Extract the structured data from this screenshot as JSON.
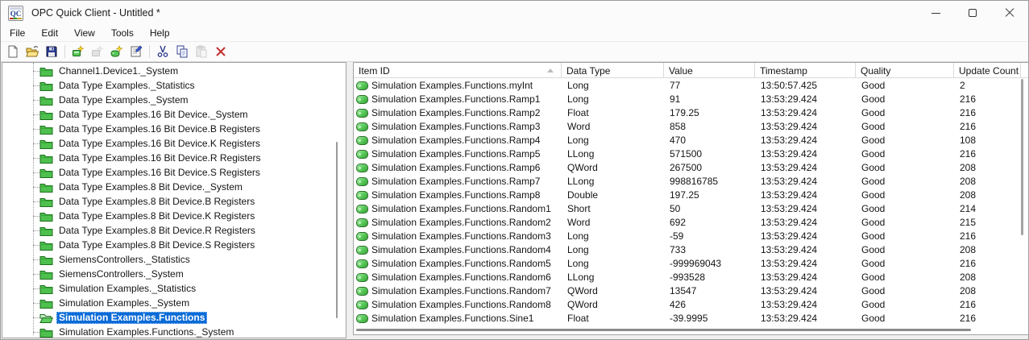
{
  "window": {
    "title": "OPC Quick Client - Untitled *",
    "app_icon_text": "QC"
  },
  "menu": {
    "items": [
      "File",
      "Edit",
      "View",
      "Tools",
      "Help"
    ]
  },
  "toolbar": {
    "buttons": [
      {
        "name": "new-document",
        "enabled": true
      },
      {
        "name": "open-file",
        "enabled": true
      },
      {
        "name": "save-file",
        "enabled": true
      },
      {
        "name": "separator"
      },
      {
        "name": "new-server-connection",
        "enabled": true
      },
      {
        "name": "new-group",
        "enabled": false
      },
      {
        "name": "new-item",
        "enabled": true
      },
      {
        "name": "properties",
        "enabled": true
      },
      {
        "name": "separator"
      },
      {
        "name": "cut",
        "enabled": true
      },
      {
        "name": "copy",
        "enabled": true
      },
      {
        "name": "paste",
        "enabled": false
      },
      {
        "name": "delete",
        "enabled": true
      }
    ]
  },
  "tree": {
    "items": [
      {
        "label": "Channel1.Device1._System"
      },
      {
        "label": "Data Type Examples._Statistics"
      },
      {
        "label": "Data Type Examples._System"
      },
      {
        "label": "Data Type Examples.16 Bit Device._System"
      },
      {
        "label": "Data Type Examples.16 Bit Device.B Registers"
      },
      {
        "label": "Data Type Examples.16 Bit Device.K Registers"
      },
      {
        "label": "Data Type Examples.16 Bit Device.R Registers"
      },
      {
        "label": "Data Type Examples.16 Bit Device.S Registers"
      },
      {
        "label": "Data Type Examples.8 Bit Device._System"
      },
      {
        "label": "Data Type Examples.8 Bit Device.B Registers"
      },
      {
        "label": "Data Type Examples.8 Bit Device.K Registers"
      },
      {
        "label": "Data Type Examples.8 Bit Device.R Registers"
      },
      {
        "label": "Data Type Examples.8 Bit Device.S Registers"
      },
      {
        "label": "SiemensControllers._Statistics"
      },
      {
        "label": "SiemensControllers._System"
      },
      {
        "label": "Simulation Examples._Statistics"
      },
      {
        "label": "Simulation Examples._System"
      },
      {
        "label": "Simulation Examples.Functions",
        "selected": true,
        "open": true
      },
      {
        "label": "Simulation Examples.Functions._System"
      }
    ]
  },
  "grid": {
    "columns": [
      "Item ID",
      "Data Type",
      "Value",
      "Timestamp",
      "Quality",
      "Update Count"
    ],
    "sort": {
      "column": "Item ID",
      "direction": "ascending"
    },
    "rows": [
      {
        "item_id": "Simulation Examples.Functions.myInt",
        "data_type": "Long",
        "value": "77",
        "timestamp": "13:50:57.425",
        "quality": "Good",
        "update_count": "2"
      },
      {
        "item_id": "Simulation Examples.Functions.Ramp1",
        "data_type": "Long",
        "value": "91",
        "timestamp": "13:53:29.424",
        "quality": "Good",
        "update_count": "216"
      },
      {
        "item_id": "Simulation Examples.Functions.Ramp2",
        "data_type": "Float",
        "value": "179.25",
        "timestamp": "13:53:29.424",
        "quality": "Good",
        "update_count": "216"
      },
      {
        "item_id": "Simulation Examples.Functions.Ramp3",
        "data_type": "Word",
        "value": "858",
        "timestamp": "13:53:29.424",
        "quality": "Good",
        "update_count": "216"
      },
      {
        "item_id": "Simulation Examples.Functions.Ramp4",
        "data_type": "Long",
        "value": "470",
        "timestamp": "13:53:29.424",
        "quality": "Good",
        "update_count": "108"
      },
      {
        "item_id": "Simulation Examples.Functions.Ramp5",
        "data_type": "LLong",
        "value": "571500",
        "timestamp": "13:53:29.424",
        "quality": "Good",
        "update_count": "216"
      },
      {
        "item_id": "Simulation Examples.Functions.Ramp6",
        "data_type": "QWord",
        "value": "267500",
        "timestamp": "13:53:29.424",
        "quality": "Good",
        "update_count": "208"
      },
      {
        "item_id": "Simulation Examples.Functions.Ramp7",
        "data_type": "LLong",
        "value": "998816785",
        "timestamp": "13:53:29.424",
        "quality": "Good",
        "update_count": "208"
      },
      {
        "item_id": "Simulation Examples.Functions.Ramp8",
        "data_type": "Double",
        "value": "197.25",
        "timestamp": "13:53:29.424",
        "quality": "Good",
        "update_count": "208"
      },
      {
        "item_id": "Simulation Examples.Functions.Random1",
        "data_type": "Short",
        "value": "50",
        "timestamp": "13:53:29.424",
        "quality": "Good",
        "update_count": "214"
      },
      {
        "item_id": "Simulation Examples.Functions.Random2",
        "data_type": "Word",
        "value": "692",
        "timestamp": "13:53:29.424",
        "quality": "Good",
        "update_count": "215"
      },
      {
        "item_id": "Simulation Examples.Functions.Random3",
        "data_type": "Long",
        "value": "-59",
        "timestamp": "13:53:29.424",
        "quality": "Good",
        "update_count": "216"
      },
      {
        "item_id": "Simulation Examples.Functions.Random4",
        "data_type": "Long",
        "value": "733",
        "timestamp": "13:53:29.424",
        "quality": "Good",
        "update_count": "208"
      },
      {
        "item_id": "Simulation Examples.Functions.Random5",
        "data_type": "Long",
        "value": "-999969043",
        "timestamp": "13:53:29.424",
        "quality": "Good",
        "update_count": "216"
      },
      {
        "item_id": "Simulation Examples.Functions.Random6",
        "data_type": "LLong",
        "value": "-993528",
        "timestamp": "13:53:29.424",
        "quality": "Good",
        "update_count": "208"
      },
      {
        "item_id": "Simulation Examples.Functions.Random7",
        "data_type": "QWord",
        "value": "13547",
        "timestamp": "13:53:29.424",
        "quality": "Good",
        "update_count": "208"
      },
      {
        "item_id": "Simulation Examples.Functions.Random8",
        "data_type": "QWord",
        "value": "426",
        "timestamp": "13:53:29.424",
        "quality": "Good",
        "update_count": "216"
      },
      {
        "item_id": "Simulation Examples.Functions.Sine1",
        "data_type": "Float",
        "value": "-39.9995",
        "timestamp": "13:53:29.424",
        "quality": "Good",
        "update_count": "216"
      }
    ]
  },
  "colors": {
    "selection_blue": "#0b6bd7",
    "folder_green": "#4ec04e",
    "tag_green": "#57c757",
    "delete_red": "#c23030"
  }
}
